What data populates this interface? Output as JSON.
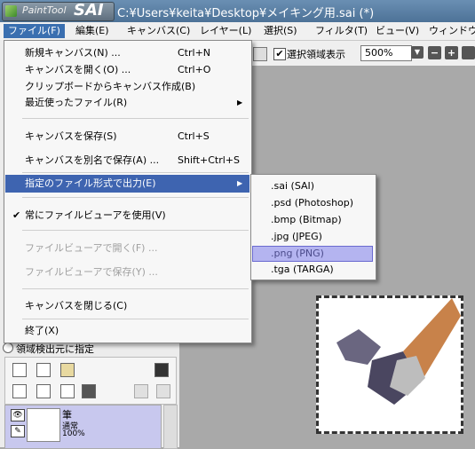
{
  "app": {
    "logo_text": "PaintTool",
    "logo_sai": "SAI",
    "window_title": "C:¥Users¥keita¥Desktop¥メイキング用.sai (*)"
  },
  "menubar": [
    {
      "label": "ファイル(F)",
      "active": true
    },
    {
      "label": "編集(E)"
    },
    {
      "label": "キャンバス(C)"
    },
    {
      "label": "レイヤー(L)"
    },
    {
      "label": "選択(S)"
    },
    {
      "label": "フィルタ(T)"
    },
    {
      "label": "ビュー(V)"
    },
    {
      "label": "ウィンドウ(W)"
    }
  ],
  "toolbar": {
    "selection_display_checked": true,
    "selection_display_label": "選択領域表示",
    "zoom_value": "500%",
    "minus_label": "−",
    "plus_label": "+"
  },
  "file_menu": {
    "items": [
      {
        "label": "新規キャンバス(N) ...",
        "shortcut": "Ctrl+N"
      },
      {
        "label": "キャンバスを開く(O) ...",
        "shortcut": "Ctrl+O"
      },
      {
        "label": "クリップボードからキャンバス作成(B)",
        "shortcut": ""
      },
      {
        "label": "最近使ったファイル(R)",
        "shortcut": "",
        "submenu": true
      },
      {
        "label": "キャンバスを保存(S)",
        "shortcut": "Ctrl+S"
      },
      {
        "label": "キャンバスを別名で保存(A) ...",
        "shortcut": "Shift+Ctrl+S"
      },
      {
        "label": "指定のファイル形式で出力(E)",
        "shortcut": "",
        "submenu": true,
        "highlight": true
      },
      {
        "label": "常にファイルビューアを使用(V)",
        "shortcut": "",
        "checked": true
      },
      {
        "label": "ファイルビューアで開く(F) ...",
        "shortcut": "",
        "disabled": true
      },
      {
        "label": "ファイルビューアで保存(Y) ...",
        "shortcut": "",
        "disabled": true
      },
      {
        "label": "キャンバスを閉じる(C)",
        "shortcut": ""
      },
      {
        "label": "終了(X)",
        "shortcut": ""
      }
    ],
    "check_mark": "✔",
    "submenu_arrow": "▶"
  },
  "export_submenu": {
    "items": [
      {
        "label": ".sai (SAI)"
      },
      {
        "label": ".psd (Photoshop)"
      },
      {
        "label": ".bmp (Bitmap)"
      },
      {
        "label": ".jpg (JPEG)"
      },
      {
        "label": ".png (PNG)",
        "highlight": true
      },
      {
        "label": ".tga (TARGA)"
      }
    ]
  },
  "layer_panel": {
    "radio_label": "領域検出元に指定",
    "layer": {
      "name": "筆",
      "mode": "通常",
      "opacity": "100%"
    }
  },
  "colors": {
    "menu_highlight": "#3e64b0",
    "submenu_highlight": "#b4b4f0",
    "layer_selected": "#c8c8ee",
    "workspace": "#a9a9a9"
  }
}
